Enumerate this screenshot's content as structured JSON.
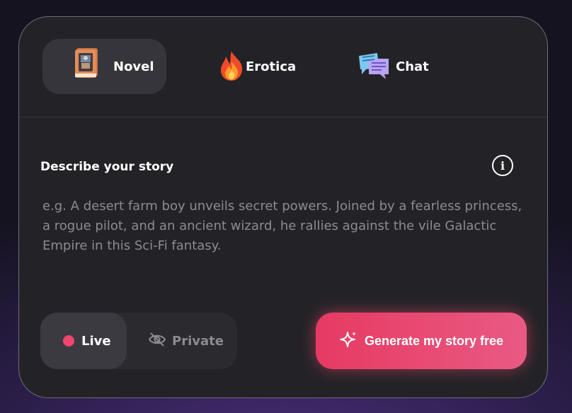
{
  "tabs": [
    {
      "label": "Novel",
      "icon": "book-icon",
      "active": true
    },
    {
      "label": "Erotica",
      "icon": "fire-icon",
      "active": false
    },
    {
      "label": "Chat",
      "icon": "chat-bubbles-icon",
      "active": false
    }
  ],
  "story": {
    "label": "Describe your story",
    "placeholder": "e.g. A desert farm boy unveils secret powers. Joined by a fearless princess, a rogue pilot, and an ancient wizard, he rallies against the vile Galactic Empire in this Sci-Fi fantasy.",
    "value": ""
  },
  "visibility": {
    "options": [
      {
        "label": "Live",
        "selected": true
      },
      {
        "label": "Private",
        "selected": false
      }
    ]
  },
  "generate_button": {
    "label": "Generate my story free"
  },
  "colors": {
    "accent": "#e63a63",
    "live_dot": "#f0456e",
    "card_bg": "#232327"
  }
}
